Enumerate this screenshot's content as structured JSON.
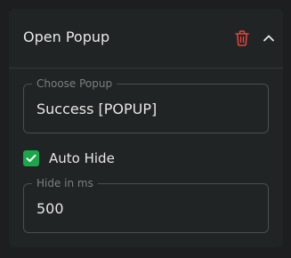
{
  "header": {
    "title": "Open Popup"
  },
  "icons": {
    "delete": "trash-icon",
    "collapse": "chevron-up-icon",
    "check": "checkmark-icon"
  },
  "fields": {
    "popup": {
      "label": "Choose Popup",
      "value": "Success [POPUP]"
    },
    "hide_ms": {
      "label": "Hide in ms",
      "value": "500"
    }
  },
  "auto_hide": {
    "label": "Auto Hide",
    "checked": true
  },
  "colors": {
    "background": "#1c1e1f",
    "panel": "#212425",
    "accent_green": "#1aa74a",
    "danger_red": "#e0443a",
    "border": "#4a4e50"
  }
}
